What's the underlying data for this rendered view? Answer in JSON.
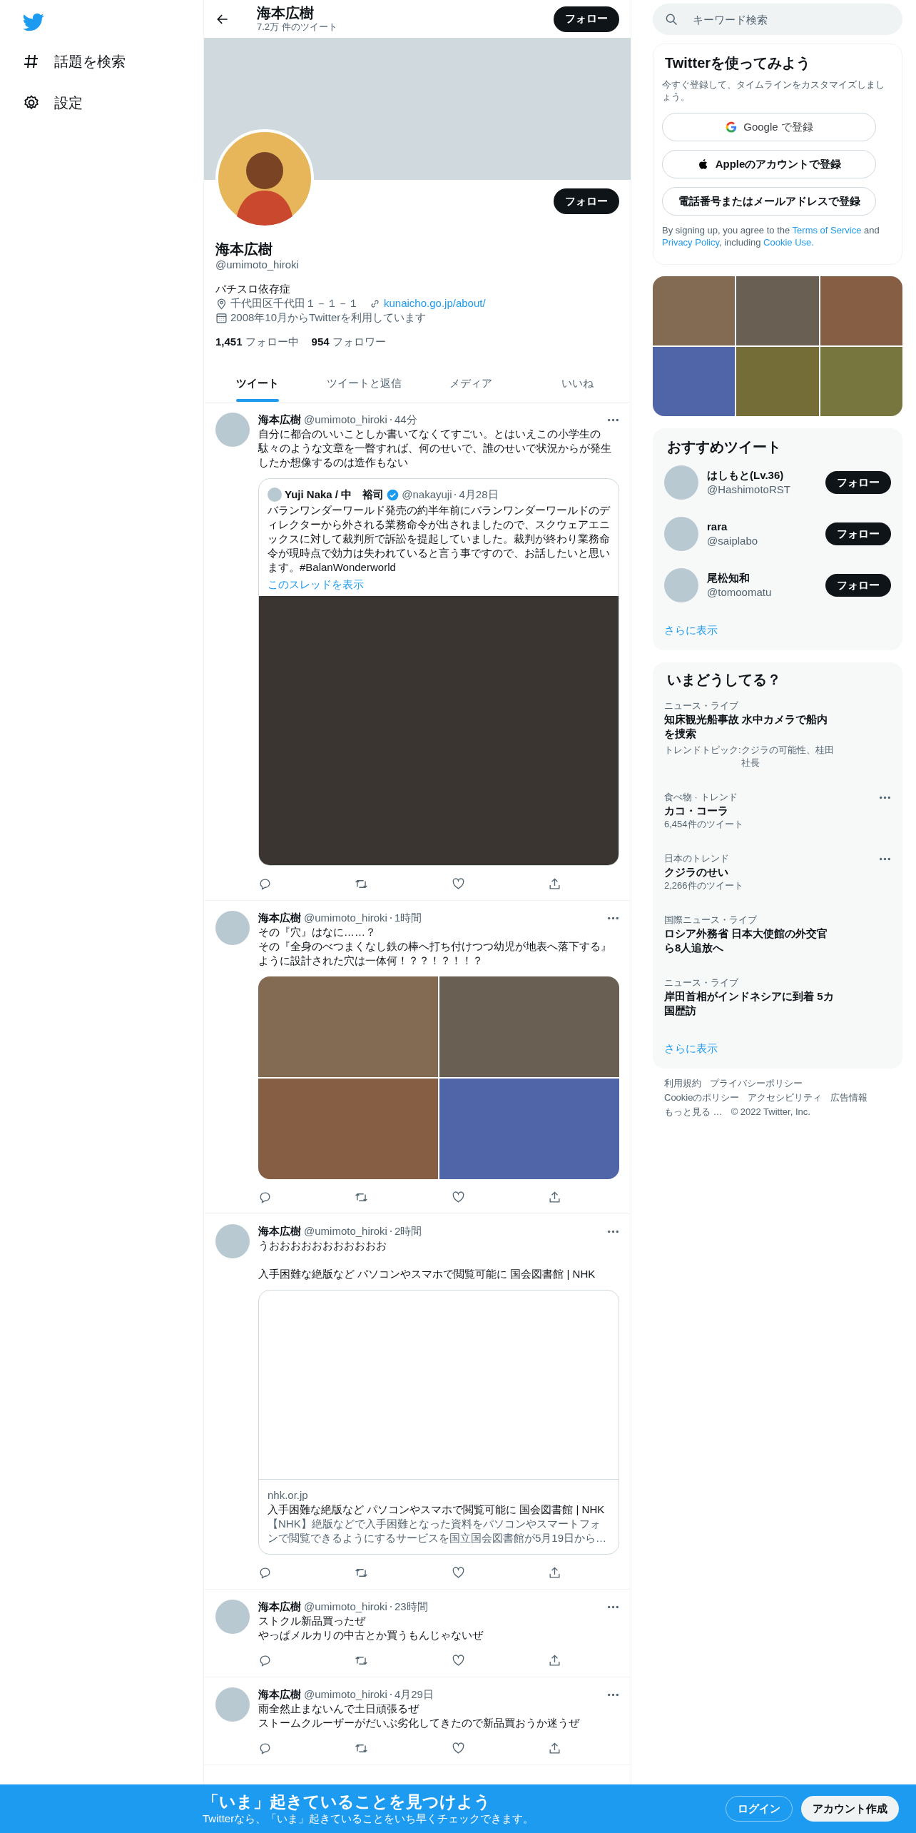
{
  "nav": {
    "items": [
      {
        "label": "話題を検索",
        "kind": "hash"
      },
      {
        "label": "設定",
        "kind": "gear"
      }
    ]
  },
  "header": {
    "title": "海本広樹",
    "subtitle": "7.2万 件のツイート",
    "button": "フォロー"
  },
  "profile": {
    "follow_button": "フォロー",
    "name": "海本広樹",
    "handle": "@umimoto_hiroki",
    "bio": "パチスロ依存症",
    "location": "千代田区千代田１－１－１",
    "url": "kunaicho.go.jp/about/",
    "joined": "2008年10月からTwitterを利用しています",
    "following_count": "1,451",
    "following_label": "フォロー中",
    "followers_count": "954",
    "followers_label": "フォロワー"
  },
  "tabs": [
    {
      "label": "ツイート",
      "selected": true
    },
    {
      "label": "ツイートと返信",
      "selected": false
    },
    {
      "label": "メディア",
      "selected": false
    },
    {
      "label": "いいね",
      "selected": false
    }
  ],
  "tweets": [
    {
      "name": "海本広樹",
      "handle": "@umimoto_hiroki",
      "time": "44分",
      "paragraphs": [
        [
          "自分に都合のいいことしか書いてなくてすごい。とはいえこの小学生の駄々のような文章を一瞥すれば、何のせいで、誰のせいで状況からが発生したか想像するのは造作もない"
        ]
      ],
      "media": {
        "kind": "quote",
        "author": "Yuji Naka / 中　裕司",
        "verified": true,
        "handle": "@nakayuji",
        "date": "4月28日",
        "text": "バランワンダーワールド発売の約半年前にバランワンダーワールドのディレクターから外される業務命令が出されましたので、スクウェアエニックスに対して裁判所で訴訟を提起していました。裁判が終わり業務命令が現時点で効力は失われていると言う事ですので、お話したいと思います。#BalanWonderworld",
        "link": "このスレッドを表示"
      }
    },
    {
      "name": "海本広樹",
      "handle": "@umimoto_hiroki",
      "time": "1時間",
      "paragraphs": [
        [
          "その『穴』はなに……？",
          "その『全身のべつまくなし鉄の棒へ打ち付けつつ幼児が地表へ落下する』ように設計された穴は一体何！？？！？！！？"
        ]
      ],
      "media": {
        "kind": "photos",
        "tiles": [
          {
            "color": "#836a52"
          },
          {
            "color": "#6a5f53"
          },
          {
            "color": "#865e44"
          },
          {
            "color": "#5064a8"
          }
        ]
      }
    },
    {
      "name": "海本広樹",
      "handle": "@umimoto_hiroki",
      "time": "2時間",
      "paragraphs": [
        [
          "うおおおおおおおおおおお"
        ],
        [
          "入手困難な絶版など パソコンやスマホで閲覧可能に 国会図書館 | NHK"
        ]
      ],
      "media": {
        "kind": "card",
        "domain": "nhk.or.jp",
        "title": "入手困難な絶版など パソコンやスマホで閲覧可能に 国会図書館 | NHK",
        "description": "【NHK】絶版などで入手困難となった資料をパソコンやスマートフォンで閲覧できるようにするサービスを国立国会図書館が5月19日から…"
      }
    },
    {
      "name": "海本広樹",
      "handle": "@umimoto_hiroki",
      "time": "23時間",
      "paragraphs": [
        [
          "ストクル新品買ったぜ",
          "やっぱメルカリの中古とか買うもんじゃないぜ"
        ]
      ]
    },
    {
      "name": "海本広樹",
      "handle": "@umimoto_hiroki",
      "time": "4月29日",
      "paragraphs": [
        [
          "雨全然止まないんで土日頑張るぜ",
          "ストームクルーザーがだいぶ劣化してきたので新品買おうか迷うぜ"
        ]
      ]
    }
  ],
  "search": {
    "placeholder": "キーワード検索"
  },
  "signup": {
    "title": "Twitterを使ってみよう",
    "subtitle": "今すぐ登録して、タイムラインをカスタマイズしましょう。",
    "buttons": [
      {
        "label": "Google で登録",
        "kind": "google"
      },
      {
        "label": "Appleのアカウントで登録",
        "kind": "apple"
      },
      {
        "label": "電話番号またはメールアドレスで登録",
        "kind": "plain"
      }
    ],
    "legal": [
      {
        "text": "By signing up, you agree to the ",
        "kind": "text"
      },
      {
        "text": "Terms of Service",
        "kind": "link"
      },
      {
        "text": " and ",
        "kind": "text"
      },
      {
        "text": "Privacy Policy",
        "kind": "link"
      },
      {
        "text": ", including ",
        "kind": "text"
      },
      {
        "text": "Cookie Use.",
        "kind": "link"
      }
    ]
  },
  "media_tiles": [
    {
      "color": "#836a52"
    },
    {
      "color": "#6a5f53"
    },
    {
      "color": "#865e44"
    },
    {
      "color": "#5064a8"
    },
    {
      "color": "#756d38"
    },
    {
      "color": "#77763e"
    }
  ],
  "recommended": {
    "title": "おすすめツイート",
    "users": [
      {
        "name": "はしもと(Lv.36)",
        "handle": "@HashimotoRST",
        "button": "フォロー"
      },
      {
        "name": "rara",
        "handle": "@saiplabo",
        "button": "フォロー"
      },
      {
        "name": "尾松知和",
        "handle": "@tomoomatu",
        "button": "フォロー"
      }
    ],
    "more": "さらに表示"
  },
  "trends": {
    "title": "いまどうしてる？",
    "items": [
      {
        "context": "ニュース・ライブ",
        "title": "知床観光船事故 水中カメラで船内を捜索",
        "topics_label": "トレンドトピック: ",
        "topics": "クジラの可能性、桂田社長",
        "more": false
      },
      {
        "context": "食べ物 · トレンド",
        "title": "カコ・コーラ",
        "count": "6,454件のツイート",
        "more": true
      },
      {
        "context": "日本のトレンド",
        "title": "クジラのせい",
        "count": "2,266件のツイート",
        "more": true
      },
      {
        "context": "国際ニュース・ライブ",
        "title": "ロシア外務省 日本大使館の外交官ら8人追放へ",
        "more": false
      },
      {
        "context": "ニュース・ライブ",
        "title": "岸田首相がインドネシアに到着 5カ国歴訪",
        "more": false
      }
    ],
    "more": "さらに表示"
  },
  "footer": {
    "links": [
      "利用規約",
      "プライバシーポリシー",
      "Cookieのポリシー",
      "アクセシビリティ",
      "広告情報",
      "もっと見る …"
    ],
    "copyright": "© 2022 Twitter, Inc."
  },
  "bottom_bar": {
    "title": "「いま」起きていることを見つけよう",
    "subtitle": "Twitterなら、「いま」起きていることをいち早くチェックできます。",
    "login": "ログイン",
    "signup": "アカウント作成"
  }
}
